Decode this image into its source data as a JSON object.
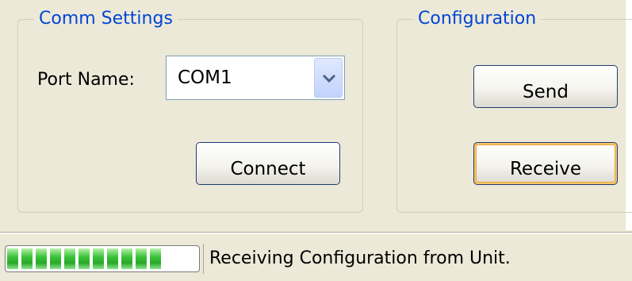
{
  "comm_settings": {
    "title": "Comm Settings",
    "port_label": "Port Name:",
    "port_value": "COM1",
    "connect_label": "Connect"
  },
  "configuration": {
    "title": "Configuration",
    "send_label": "Send",
    "receive_label": "Receive"
  },
  "statusbar": {
    "progress_blocks": 11,
    "text": "Receiving Configuration from Unit."
  },
  "colors": {
    "group_title": "#0046d5",
    "progress": "#3cc43c",
    "focus_ring": "#e9a53b"
  },
  "icons": {
    "combo_drop": "chevron-down-icon"
  }
}
